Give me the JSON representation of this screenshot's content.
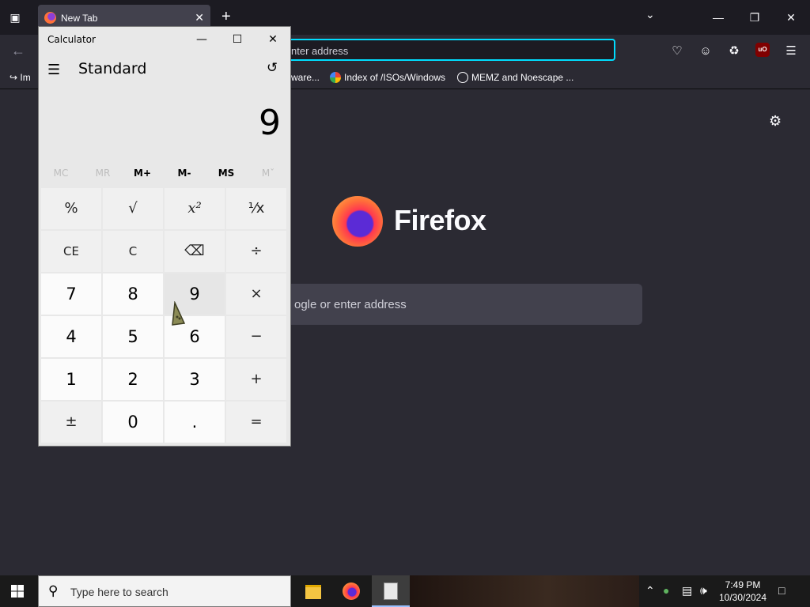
{
  "firefox": {
    "tab_title": "New Tab",
    "url_placeholder": "nter address",
    "bookmarks": [
      {
        "label": "Im"
      },
      {
        "label": "ware..."
      },
      {
        "label": "Index of /ISOs/Windows"
      },
      {
        "label": "MEMZ and Noescape ..."
      }
    ],
    "wordmark": "Firefox",
    "search_placeholder": "ogle or enter address"
  },
  "calculator": {
    "title": "Calculator",
    "mode": "Standard",
    "display": "9",
    "memory": [
      "MC",
      "MR",
      "M+",
      "M-",
      "MS",
      "Mˇ"
    ],
    "memory_enabled": [
      false,
      false,
      true,
      true,
      true,
      false
    ],
    "keys": [
      [
        "%",
        "√",
        "x²",
        "¹⁄x"
      ],
      [
        "CE",
        "C",
        "⌫",
        "÷"
      ],
      [
        "7",
        "8",
        "9",
        "×"
      ],
      [
        "4",
        "5",
        "6",
        "−"
      ],
      [
        "1",
        "2",
        "3",
        "+"
      ],
      [
        "±",
        "0",
        ".",
        "="
      ]
    ]
  },
  "taskbar": {
    "search_placeholder": "Type here to search",
    "time": "7:49 PM",
    "date": "10/30/2024"
  },
  "colors": {
    "firefox_bg": "#2b2a33",
    "urlbar_focus": "#00ddff",
    "calc_bg": "#e8e8e8"
  }
}
